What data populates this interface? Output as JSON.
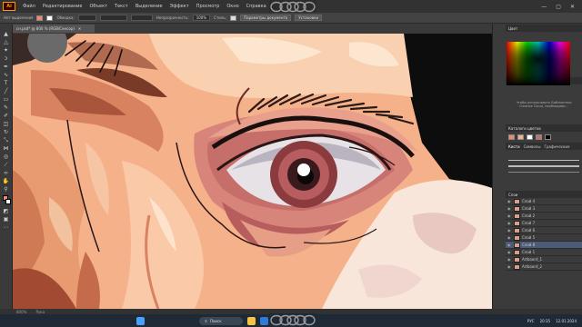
{
  "app": {
    "logo": "Ai"
  },
  "menu": [
    "Файл",
    "Редактирование",
    "Объект",
    "Текст",
    "Выделение",
    "Эффект",
    "Просмотр",
    "Окно",
    "Справка"
  ],
  "window_controls": {
    "minimize": "—",
    "maximize": "▢",
    "close": "✕"
  },
  "control_bar": {
    "no_selection": "Нет выделения",
    "stroke_label": "Обводка:",
    "opacity_label": "Непрозрачность:",
    "opacity_value": "100%",
    "style_label": "Стиль:",
    "doc_setup": "Параметры документа",
    "preferences": "Установки"
  },
  "document_tab": {
    "name": "сн.psd* @ 800 % (RGB/Сенсор)",
    "close": "✕"
  },
  "panels": {
    "color_title": "Цвет",
    "library_tabs": [
      "Образцы",
      "Библиотеки"
    ],
    "library_note": "Чтобы использовать Библиотеки Creative Cloud, необходимо...",
    "swatch_title": "Каталоги цветов",
    "swatch_tabs": [
      "Кисти",
      "Символы",
      "Графические"
    ],
    "layers_title": "Слои",
    "layers": [
      {
        "name": "Слой 4",
        "selected": false
      },
      {
        "name": "Слой 3",
        "selected": false
      },
      {
        "name": "Слой 2",
        "selected": false
      },
      {
        "name": "Слой 7",
        "selected": false
      },
      {
        "name": "Слой 6",
        "selected": false
      },
      {
        "name": "Слой 5",
        "selected": false
      },
      {
        "name": "Слой 8",
        "selected": true
      },
      {
        "name": "Слой 1",
        "selected": false
      },
      {
        "name": "Artboard_1",
        "selected": false
      },
      {
        "name": "Artboard_2",
        "selected": false
      }
    ]
  },
  "status": {
    "zoom": "800%",
    "tool": "Рука"
  },
  "taskbar": {
    "search_placeholder": "Поиск",
    "time": "20:35",
    "date": "12.01.2024",
    "lang": "РУС"
  },
  "colors": {
    "accent": "#4b5b78",
    "skin": "#f5b28a",
    "iris": "#8b3b3e"
  }
}
